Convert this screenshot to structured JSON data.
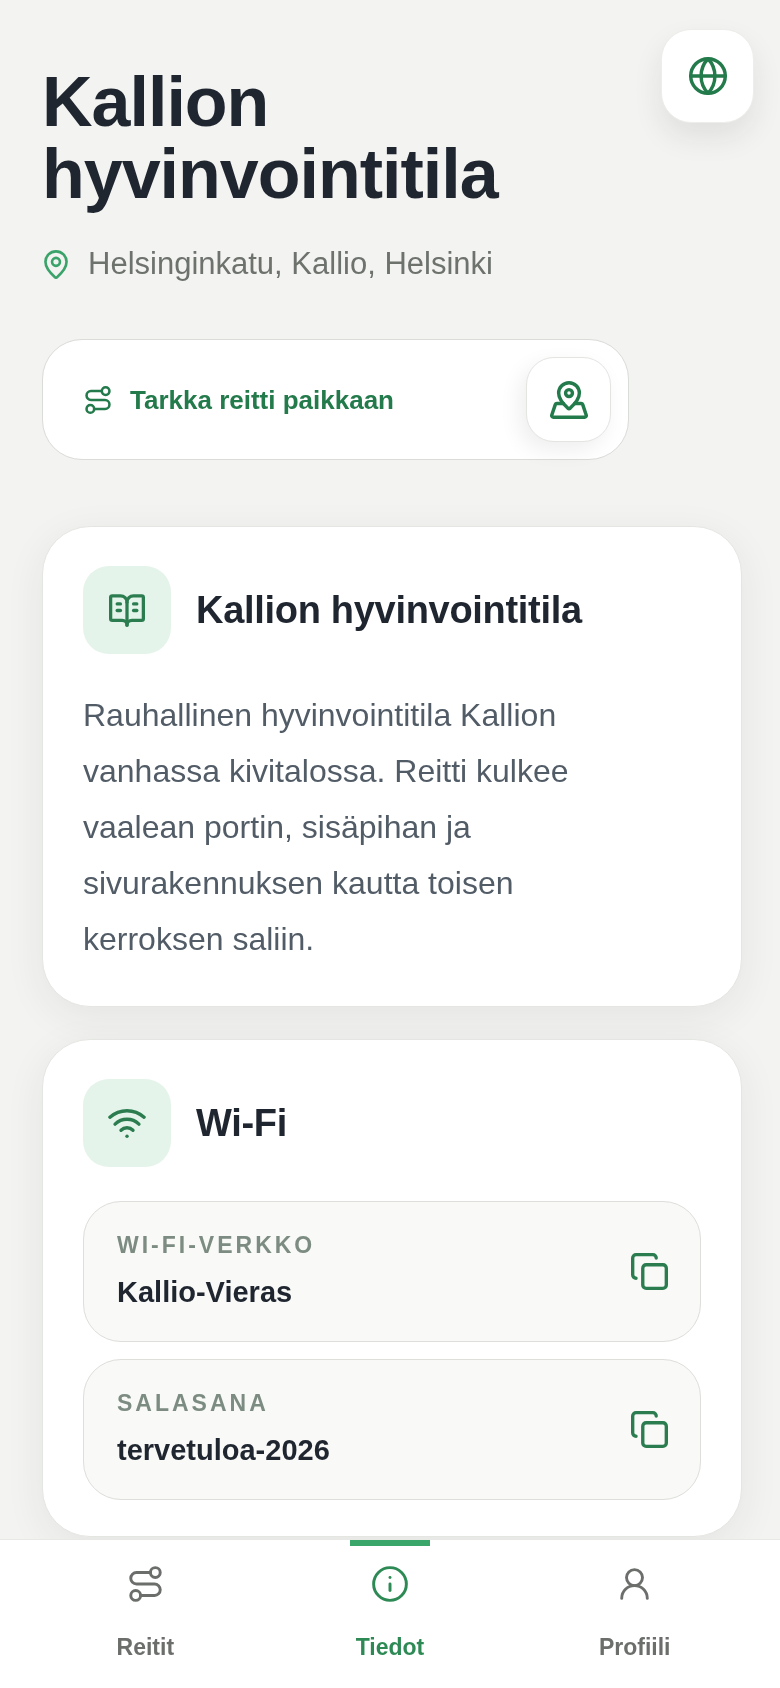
{
  "header": {
    "title": "Kallion hyvinvointitila",
    "location": "Helsinginkatu, Kallio, Helsinki"
  },
  "route": {
    "label": "Tarkka reitti paikkaan"
  },
  "cards": [
    {
      "kind": "text",
      "title": "Kallion hyvinvointitila",
      "body": "Rauhallinen hyvinvointitila Kallion vanhassa kivitalossa. Reitti kulkee vaalean portin, sisäpihan ja sivurakennuksen kautta toisen kerroksen saliin."
    },
    {
      "kind": "fields",
      "title": "Wi-Fi",
      "fields": [
        {
          "label": "WI-FI-VERKKO",
          "value": "Kallio-Vieras"
        },
        {
          "label": "SALASANA",
          "value": "tervetuloa-2026"
        }
      ]
    }
  ],
  "nav": {
    "tabs": [
      {
        "label": "Reitit",
        "selected": false
      },
      {
        "label": "Tiedot",
        "selected": true
      },
      {
        "label": "Profiili",
        "selected": false
      }
    ]
  }
}
